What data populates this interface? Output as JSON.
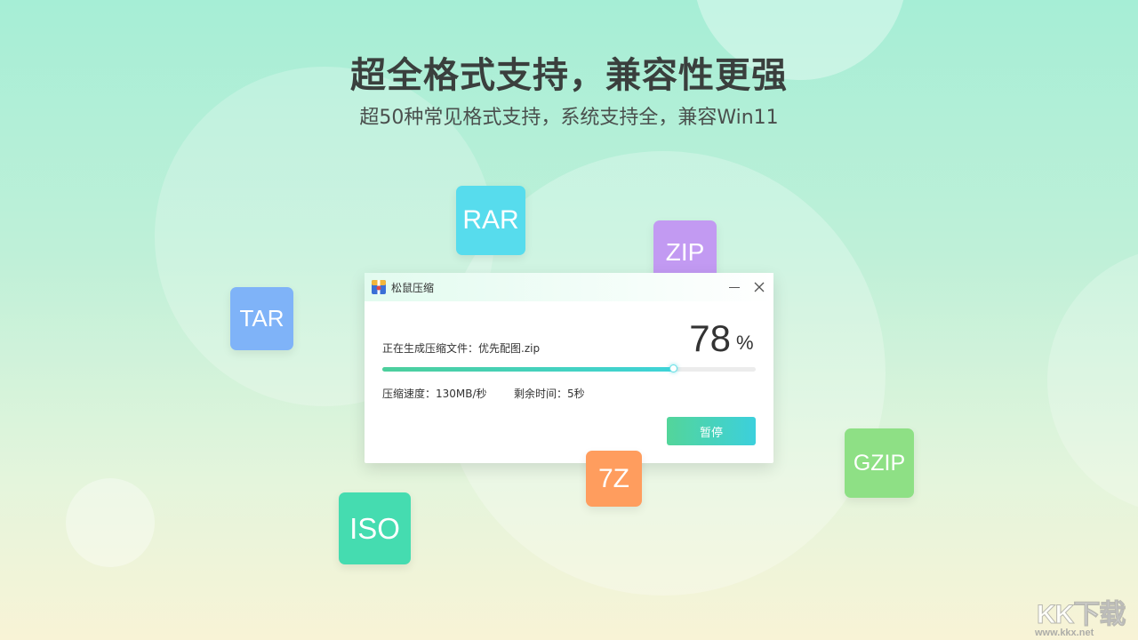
{
  "hero": {
    "headline": "超全格式支持，兼容性更强",
    "subline": "超50种常见格式支持，系统支持全，兼容Win11"
  },
  "format_tiles": [
    {
      "label": "RAR",
      "color": "#57dced"
    },
    {
      "label": "ZIP",
      "color": "#c29af2"
    },
    {
      "label": "TAR",
      "color": "#7fb3f8"
    },
    {
      "label": "7Z",
      "color": "#ff9d5e"
    },
    {
      "label": "GZIP",
      "color": "#8ee085"
    },
    {
      "label": "ISO",
      "color": "#45dcb0"
    }
  ],
  "window": {
    "title": "松鼠压缩",
    "icon": "squirrel-app-icon",
    "file_status": "正在生成压缩文件：优先配图.zip",
    "percent": "78",
    "percent_sign": "%",
    "progress": 0.78,
    "speed": "压缩速度：130MB/秒",
    "remaining": "剩余时间：5秒",
    "pause_label": "暂停"
  },
  "watermark": {
    "logo_text": "KK下载",
    "url": "www.kkx.net"
  },
  "colors": {
    "accent_start": "#4ccf9c",
    "accent_end": "#3ed3d8",
    "text_dark": "#333333"
  }
}
